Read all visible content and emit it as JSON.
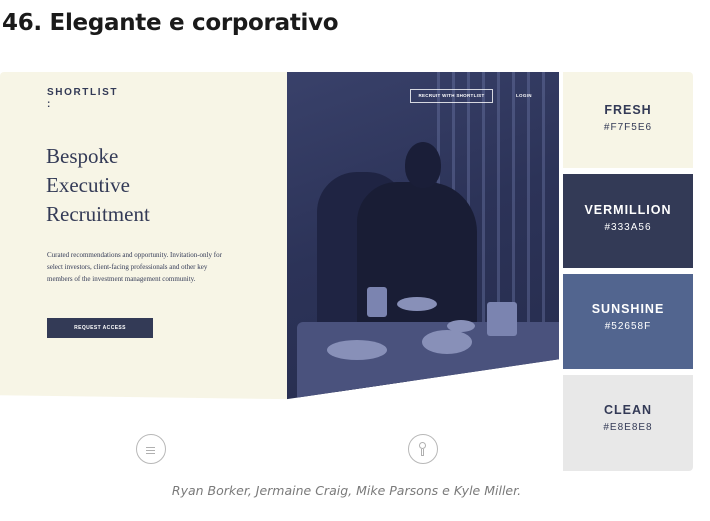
{
  "heading": "46. Elegante e corporativo",
  "mockup": {
    "logo": "SHORTLIST",
    "logo_mark": ":",
    "hero_title_lines": [
      "Bespoke",
      "Executive",
      "Recruitment"
    ],
    "hero_description": "Curated recommendations and opportunity. Invitation-only for select investors, client-facing professionals and other key members of the investment management community.",
    "cta_label": "REQUEST ACCESS",
    "nav_recruit": "RECRUIT WITH SHORTLIST",
    "nav_login": "LOGIN",
    "left_icon": "menu-icon",
    "mid_icon": "keyhole-icon"
  },
  "palette": [
    {
      "name": "FRESH",
      "hex": "#F7F5E6",
      "color": "#F7F5E6"
    },
    {
      "name": "VERMILLION",
      "hex": "#333A56",
      "color": "#333A56"
    },
    {
      "name": "SUNSHINE",
      "hex": "#52658F",
      "color": "#52658F"
    },
    {
      "name": "CLEAN",
      "hex": "#E8E8E8",
      "color": "#E8E8E8"
    }
  ],
  "caption": "Ryan Borker, Jermaine Craig, Mike Parsons e Kyle Miller."
}
